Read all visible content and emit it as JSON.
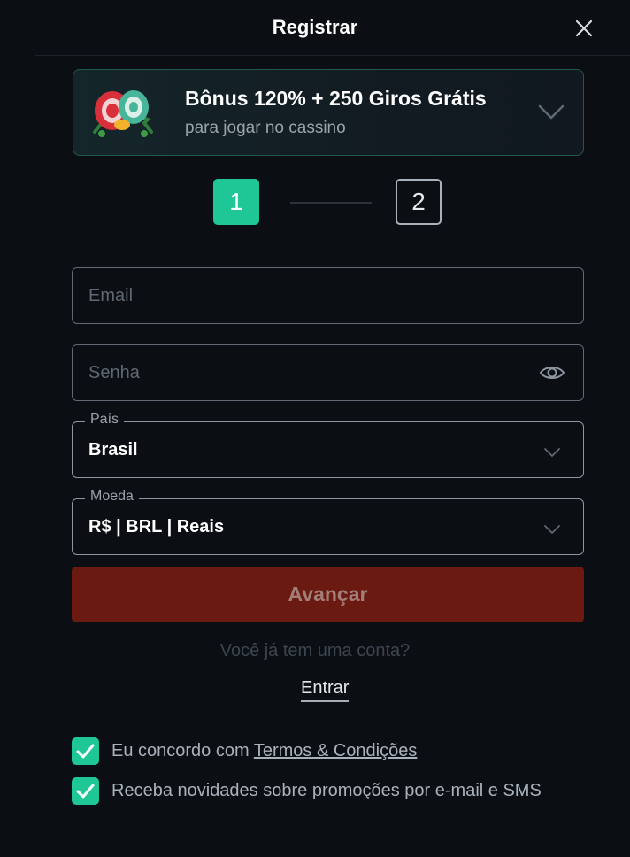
{
  "header": {
    "title": "Registrar",
    "close_icon": "close-icon"
  },
  "bonus": {
    "title": "Bônus 120% + 250 Giros Grátis",
    "subtitle": "para jogar no cassino",
    "image_icon": "casino-chips-icon",
    "expand_icon": "chevron-down-icon"
  },
  "stepper": {
    "step1": "1",
    "step2": "2",
    "active_step": 1,
    "active_color": "#1fc796"
  },
  "form": {
    "email_placeholder": "Email",
    "password_placeholder": "Senha",
    "password_toggle_icon": "eye-icon",
    "country_label": "País",
    "country_value": "Brasil",
    "currency_label": "Moeda",
    "currency_value": "R$ | BRL | Reais",
    "submit_label": "Avançar",
    "submit_color": "#6b1a11"
  },
  "account": {
    "question": "Você já tem uma conta?",
    "login_label": "Entrar"
  },
  "consents": {
    "terms_prefix": "Eu concordo com ",
    "terms_link": "Termos & Condições",
    "terms_checked": true,
    "newsletter_label": "Receba novidades sobre promoções por e-mail e SMS",
    "newsletter_checked": true,
    "checkbox_color": "#1fc796"
  }
}
